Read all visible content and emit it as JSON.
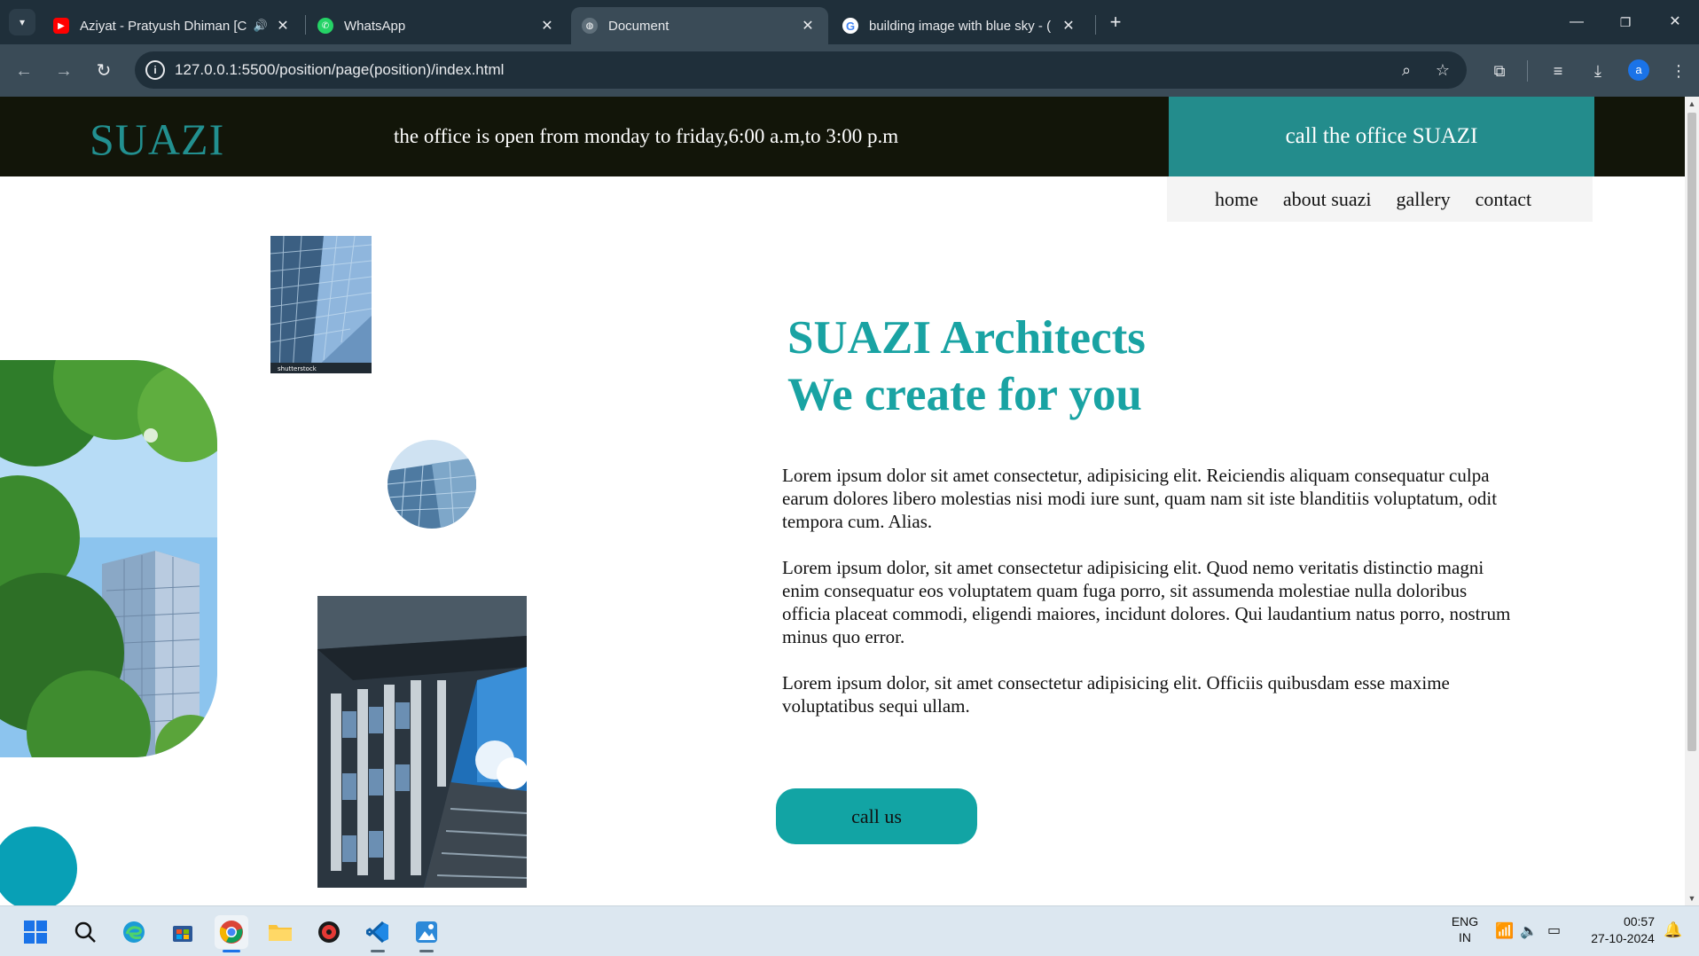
{
  "browser": {
    "tabs": [
      {
        "title": "Aziyat - Pratyush Dhiman [C",
        "favicon": "youtube-icon",
        "audio": true,
        "active": false
      },
      {
        "title": "WhatsApp",
        "favicon": "whatsapp-icon",
        "active": false
      },
      {
        "title": "Document",
        "favicon": "globe-icon",
        "active": true
      },
      {
        "title": "building image with blue sky - (",
        "favicon": "google-icon",
        "active": false
      }
    ],
    "url": "127.0.0.1:5500/position/page(position)/index.html",
    "profile_initial": "a"
  },
  "site": {
    "logo": "SUAZI",
    "hours": "the office is open from monday to friday,6:00 a.m,to 3:00 p.m",
    "call_office": "call the office SUAZI",
    "nav": [
      "home",
      "about suazi",
      "gallery",
      "contact"
    ],
    "hero_line1": "SUAZI Architects",
    "hero_line2": "We create for you",
    "paragraphs": [
      "Lorem ipsum dolor sit amet consectetur, adipisicing elit. Reiciendis aliquam consequatur culpa earum dolores libero molestias nisi modi iure sunt, quam nam sit iste blanditiis voluptatum, odit tempora cum. Alias.",
      "Lorem ipsum dolor, sit amet consectetur adipisicing elit. Quod nemo veritatis distinctio magni enim consequatur eos voluptatem quam fuga porro, sit assumenda molestiae nulla doloribus officia placeat commodi, eligendi maiores, incidunt dolores. Qui laudantium natus porro, nostrum minus quo error.",
      "Lorem ipsum dolor, sit amet consectetur adipisicing elit. Officiis quibusdam esse maxime voluptatibus sequi ullam."
    ],
    "call_us": "call us",
    "image_watermark": "shutterstock",
    "colors": {
      "accent": "#19a3a3",
      "header_bg": "#121509",
      "call_bg": "#238c8c"
    }
  },
  "taskbar": {
    "lang_line1": "ENG",
    "lang_line2": "IN",
    "time": "00:57",
    "date": "27-10-2024"
  }
}
